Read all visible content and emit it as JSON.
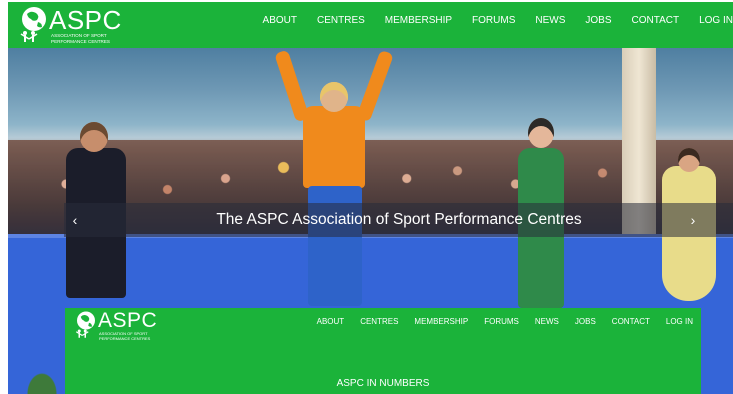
{
  "header": {
    "logo_title": "ASPC",
    "logo_sub_line1": "ASSOCIATION OF SPORT",
    "logo_sub_line2": "PERFORMANCE CENTRES",
    "nav": [
      "ABOUT",
      "CENTRES",
      "MEMBERSHIP",
      "FORUMS",
      "NEWS",
      "JOBS",
      "CONTACT",
      "LOG IN"
    ]
  },
  "hero": {
    "caption": "The ASPC Association of Sport Performance Centres",
    "prev_label": "‹",
    "next_label": "›"
  },
  "panel": {
    "logo_title": "ASPC",
    "logo_sub_line1": "ASSOCIATION OF SPORT",
    "logo_sub_line2": "PERFORMANCE CENTRES",
    "nav": [
      "ABOUT",
      "CENTRES",
      "MEMBERSHIP",
      "FORUMS",
      "NEWS",
      "JOBS",
      "CONTACT",
      "LOG IN"
    ],
    "section_title": "ASPC IN NUMBERS"
  },
  "colors": {
    "brand_green": "#1bb33a",
    "text_white": "#ffffff"
  }
}
